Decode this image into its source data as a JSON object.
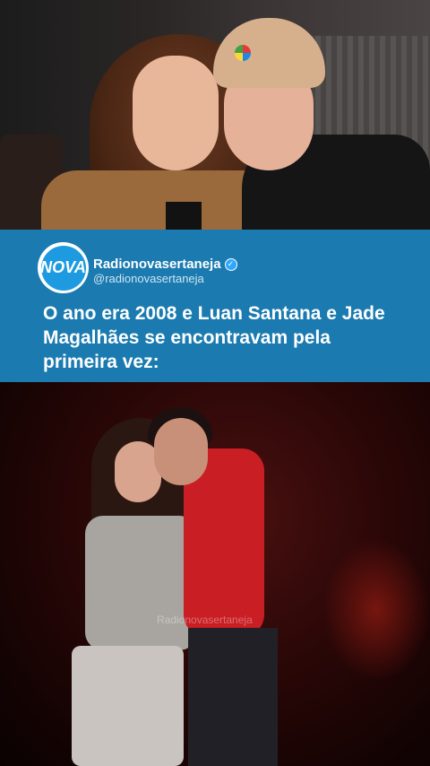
{
  "top_photo": {
    "description_icon": "couple-photo"
  },
  "post": {
    "account_name": "Radionovasertaneja",
    "handle": "@radionovasertaneja",
    "avatar_text": "NOVA",
    "verified_icon": "verified-check-icon",
    "headline": "O ano era 2008 e Luan Santana e Jade Magalhães se encontravam pela primeira vez:"
  },
  "bottom_video": {
    "watermark": "Radionovasertaneja"
  },
  "colors": {
    "banner": "#1b7bb0",
    "accent": "#2ea7ff"
  }
}
